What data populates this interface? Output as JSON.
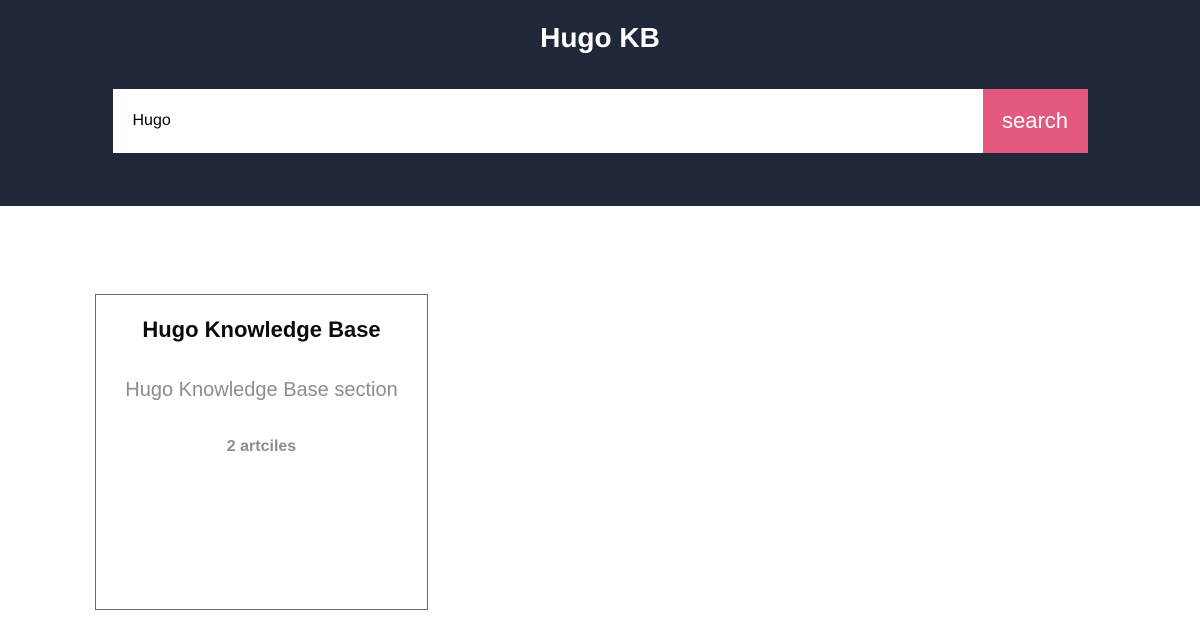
{
  "header": {
    "title": "Hugo KB",
    "search": {
      "value": "Hugo",
      "button_label": "search"
    }
  },
  "cards": [
    {
      "title": "Hugo Knowledge Base",
      "description": "Hugo Knowledge Base section",
      "count": "2 artciles"
    }
  ]
}
